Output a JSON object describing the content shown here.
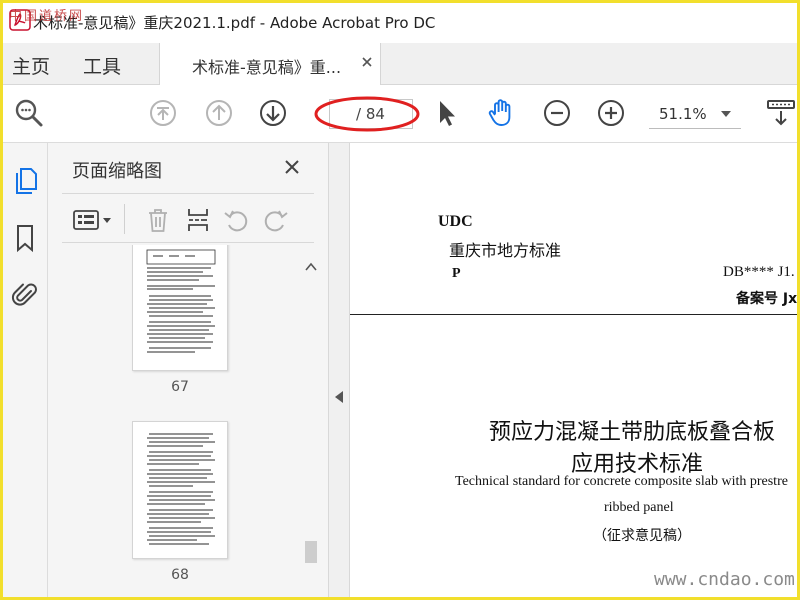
{
  "window": {
    "title": "术标准-意见稿》重庆2021.1.pdf - Adobe Acrobat Pro DC"
  },
  "tabs": {
    "home": "主页",
    "tools": "工具",
    "document": "术标准-意见稿》重...",
    "close_icon": "close-icon"
  },
  "toolbar": {
    "page_total": "/ 84",
    "zoom": "51.1%",
    "icons": [
      "zoom-search-icon",
      "first-page-icon",
      "previous-page-icon",
      "next-page-icon",
      "select-cursor-icon",
      "hand-tool-icon",
      "zoom-out-icon",
      "zoom-in-icon",
      "page-layout-icon"
    ],
    "active_color": "#1473e6",
    "annotation_color": "#e02020"
  },
  "left_rail": {
    "icons": [
      "page-thumbnails-icon",
      "bookmark-icon",
      "attachment-icon"
    ]
  },
  "thumbnails": {
    "title": "页面缩略图",
    "tools": [
      "options-menu-icon",
      "delete-page-icon",
      "insert-page-icon",
      "rotate-counterclockwise-icon",
      "rotate-clockwise-icon"
    ],
    "pages": [
      {
        "label": "67"
      },
      {
        "label": "68"
      }
    ]
  },
  "document": {
    "udc": "UDC",
    "standard_type": "重庆市地方标准",
    "p": "P",
    "db": "DB**** J1.",
    "filing": "备案号 Jxx",
    "title_line1": "预应力混凝土带肋底板叠合板",
    "title_line2": "应用技术标准",
    "english_line1": "Technical standard for concrete composite slab with prestre",
    "english_line2": "ribbed panel",
    "draft_note": "（征求意见稿）"
  },
  "watermarks": {
    "top_left": "中国道桥网",
    "bottom_right": "www.cndao.com"
  }
}
